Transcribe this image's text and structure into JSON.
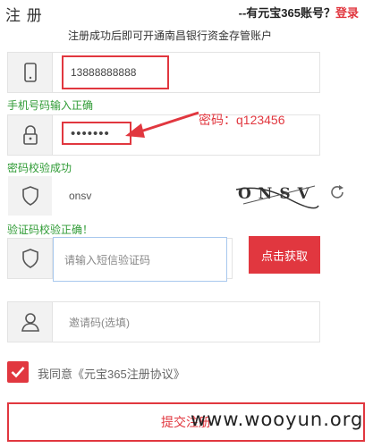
{
  "header": {
    "title": "注 册",
    "login_prompt": "--有元宝365账号？",
    "login_link": "登录",
    "subtitle": "注册成功后即可开通南昌银行资金存管账户"
  },
  "phone": {
    "value": "13888888888",
    "status": "手机号码输入正确",
    "icon": "mobile-phone-icon"
  },
  "password": {
    "value": "•••••••",
    "status": "密码校验成功",
    "icon": "lock-icon"
  },
  "annotation": {
    "text": "密码：q123456"
  },
  "captcha": {
    "value": "onsv",
    "image_text": "ONSV",
    "status": "验证码校验正确！",
    "icon": "shield-icon",
    "refresh_icon": "refresh-icon"
  },
  "sms": {
    "placeholder": "请输入短信验证码",
    "button_label": "点击获取",
    "icon": "shield-icon"
  },
  "invite": {
    "placeholder": "邀请码(选填)",
    "icon": "user-icon"
  },
  "agreement": {
    "checked": true,
    "text": "我同意《元宝365注册协议》"
  },
  "submit": {
    "label": "提交注册"
  },
  "watermark": {
    "text": "www.wooyun.org"
  },
  "colors": {
    "accent": "#e1373f",
    "success": "#2f9b35",
    "focus_border": "#a8c8ee"
  }
}
